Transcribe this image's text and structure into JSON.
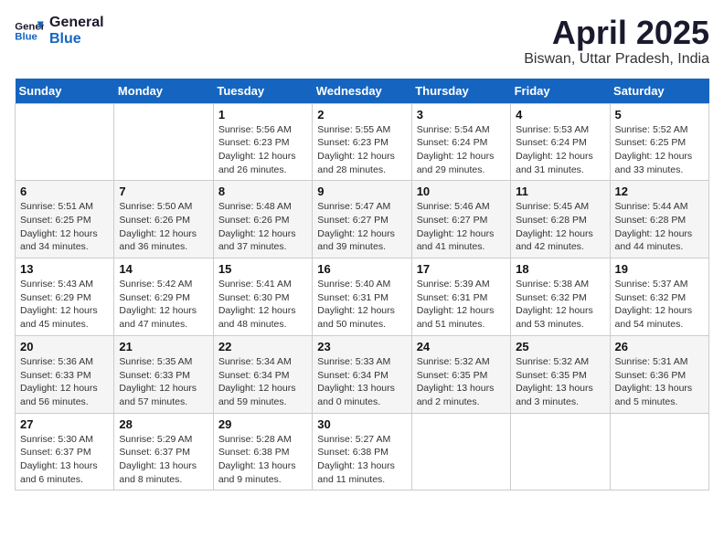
{
  "header": {
    "logo_line1": "General",
    "logo_line2": "Blue",
    "month_title": "April 2025",
    "location": "Biswan, Uttar Pradesh, India"
  },
  "days_of_week": [
    "Sunday",
    "Monday",
    "Tuesday",
    "Wednesday",
    "Thursday",
    "Friday",
    "Saturday"
  ],
  "weeks": [
    [
      {
        "day": "",
        "detail": ""
      },
      {
        "day": "",
        "detail": ""
      },
      {
        "day": "1",
        "detail": "Sunrise: 5:56 AM\nSunset: 6:23 PM\nDaylight: 12 hours\nand 26 minutes."
      },
      {
        "day": "2",
        "detail": "Sunrise: 5:55 AM\nSunset: 6:23 PM\nDaylight: 12 hours\nand 28 minutes."
      },
      {
        "day": "3",
        "detail": "Sunrise: 5:54 AM\nSunset: 6:24 PM\nDaylight: 12 hours\nand 29 minutes."
      },
      {
        "day": "4",
        "detail": "Sunrise: 5:53 AM\nSunset: 6:24 PM\nDaylight: 12 hours\nand 31 minutes."
      },
      {
        "day": "5",
        "detail": "Sunrise: 5:52 AM\nSunset: 6:25 PM\nDaylight: 12 hours\nand 33 minutes."
      }
    ],
    [
      {
        "day": "6",
        "detail": "Sunrise: 5:51 AM\nSunset: 6:25 PM\nDaylight: 12 hours\nand 34 minutes."
      },
      {
        "day": "7",
        "detail": "Sunrise: 5:50 AM\nSunset: 6:26 PM\nDaylight: 12 hours\nand 36 minutes."
      },
      {
        "day": "8",
        "detail": "Sunrise: 5:48 AM\nSunset: 6:26 PM\nDaylight: 12 hours\nand 37 minutes."
      },
      {
        "day": "9",
        "detail": "Sunrise: 5:47 AM\nSunset: 6:27 PM\nDaylight: 12 hours\nand 39 minutes."
      },
      {
        "day": "10",
        "detail": "Sunrise: 5:46 AM\nSunset: 6:27 PM\nDaylight: 12 hours\nand 41 minutes."
      },
      {
        "day": "11",
        "detail": "Sunrise: 5:45 AM\nSunset: 6:28 PM\nDaylight: 12 hours\nand 42 minutes."
      },
      {
        "day": "12",
        "detail": "Sunrise: 5:44 AM\nSunset: 6:28 PM\nDaylight: 12 hours\nand 44 minutes."
      }
    ],
    [
      {
        "day": "13",
        "detail": "Sunrise: 5:43 AM\nSunset: 6:29 PM\nDaylight: 12 hours\nand 45 minutes."
      },
      {
        "day": "14",
        "detail": "Sunrise: 5:42 AM\nSunset: 6:29 PM\nDaylight: 12 hours\nand 47 minutes."
      },
      {
        "day": "15",
        "detail": "Sunrise: 5:41 AM\nSunset: 6:30 PM\nDaylight: 12 hours\nand 48 minutes."
      },
      {
        "day": "16",
        "detail": "Sunrise: 5:40 AM\nSunset: 6:31 PM\nDaylight: 12 hours\nand 50 minutes."
      },
      {
        "day": "17",
        "detail": "Sunrise: 5:39 AM\nSunset: 6:31 PM\nDaylight: 12 hours\nand 51 minutes."
      },
      {
        "day": "18",
        "detail": "Sunrise: 5:38 AM\nSunset: 6:32 PM\nDaylight: 12 hours\nand 53 minutes."
      },
      {
        "day": "19",
        "detail": "Sunrise: 5:37 AM\nSunset: 6:32 PM\nDaylight: 12 hours\nand 54 minutes."
      }
    ],
    [
      {
        "day": "20",
        "detail": "Sunrise: 5:36 AM\nSunset: 6:33 PM\nDaylight: 12 hours\nand 56 minutes."
      },
      {
        "day": "21",
        "detail": "Sunrise: 5:35 AM\nSunset: 6:33 PM\nDaylight: 12 hours\nand 57 minutes."
      },
      {
        "day": "22",
        "detail": "Sunrise: 5:34 AM\nSunset: 6:34 PM\nDaylight: 12 hours\nand 59 minutes."
      },
      {
        "day": "23",
        "detail": "Sunrise: 5:33 AM\nSunset: 6:34 PM\nDaylight: 13 hours\nand 0 minutes."
      },
      {
        "day": "24",
        "detail": "Sunrise: 5:32 AM\nSunset: 6:35 PM\nDaylight: 13 hours\nand 2 minutes."
      },
      {
        "day": "25",
        "detail": "Sunrise: 5:32 AM\nSunset: 6:35 PM\nDaylight: 13 hours\nand 3 minutes."
      },
      {
        "day": "26",
        "detail": "Sunrise: 5:31 AM\nSunset: 6:36 PM\nDaylight: 13 hours\nand 5 minutes."
      }
    ],
    [
      {
        "day": "27",
        "detail": "Sunrise: 5:30 AM\nSunset: 6:37 PM\nDaylight: 13 hours\nand 6 minutes."
      },
      {
        "day": "28",
        "detail": "Sunrise: 5:29 AM\nSunset: 6:37 PM\nDaylight: 13 hours\nand 8 minutes."
      },
      {
        "day": "29",
        "detail": "Sunrise: 5:28 AM\nSunset: 6:38 PM\nDaylight: 13 hours\nand 9 minutes."
      },
      {
        "day": "30",
        "detail": "Sunrise: 5:27 AM\nSunset: 6:38 PM\nDaylight: 13 hours\nand 11 minutes."
      },
      {
        "day": "",
        "detail": ""
      },
      {
        "day": "",
        "detail": ""
      },
      {
        "day": "",
        "detail": ""
      }
    ]
  ]
}
